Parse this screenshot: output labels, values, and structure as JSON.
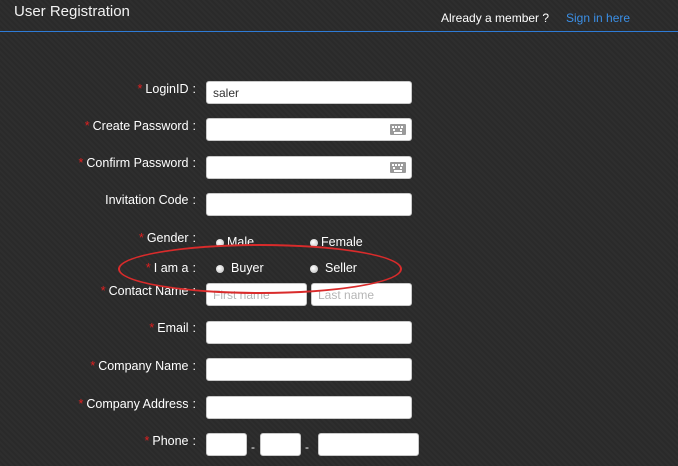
{
  "header": {
    "title": "User Registration",
    "already_member": "Already a member ?",
    "sign_in": "Sign in here"
  },
  "form": {
    "login_id": {
      "label": "LoginID",
      "value": "saler"
    },
    "create_password": {
      "label": "Create Password",
      "value": ""
    },
    "confirm_password": {
      "label": "Confirm Password",
      "value": ""
    },
    "invitation_code": {
      "label": "Invitation Code",
      "value": ""
    },
    "gender": {
      "label": "Gender",
      "options": [
        "Male",
        "Female"
      ]
    },
    "role": {
      "label": "I am a",
      "options": [
        "Buyer",
        "Seller"
      ]
    },
    "contact_name": {
      "label": "Contact Name",
      "first_placeholder": "First name",
      "last_placeholder": "Last name"
    },
    "email": {
      "label": "Email",
      "value": ""
    },
    "company_name": {
      "label": "Company Name",
      "value": ""
    },
    "company_address": {
      "label": "Company Address",
      "value": ""
    },
    "phone": {
      "label": "Phone",
      "separator": "-"
    }
  },
  "required_mark": "*",
  "colon": ":",
  "colors": {
    "accent": "#2e7bd6",
    "link": "#3b8fe6",
    "required": "#e02020",
    "annotation": "#d92b2b",
    "background": "#2b2b2b"
  },
  "icons": [
    "keyboard-icon",
    "radio-icon"
  ]
}
